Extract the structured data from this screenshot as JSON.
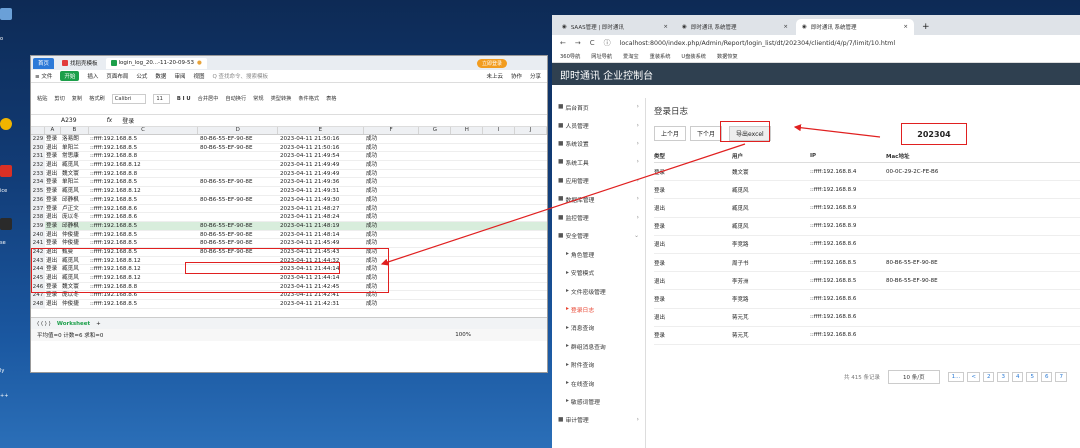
{
  "desktop": {
    "labels": [
      "o",
      "ice",
      "se",
      "ly",
      "++"
    ]
  },
  "excel": {
    "tabs": [
      {
        "label": "首页"
      },
      {
        "label": "找稻壳模板"
      },
      {
        "label": "login_log_20...-11-20-09-53"
      }
    ],
    "tab_dot": "●",
    "login_label": "立即登录",
    "menu": [
      "≡ 文件",
      "开始",
      "插入",
      "页面布局",
      "公式",
      "数据",
      "审阅",
      "视图",
      "Q 查找命令、搜索模板"
    ],
    "menu_right": [
      "未上云",
      "协作",
      "分享"
    ],
    "ribbon": [
      "粘贴",
      "剪切",
      "复制",
      "格式刷",
      "Calibri",
      "11",
      "B I U",
      "合并居中",
      "自动换行",
      "常规",
      "类型转换",
      "条件格式",
      "表格"
    ],
    "cell_ref": "A239",
    "fx": "fx",
    "formula": "登录",
    "col_headers": [
      "A",
      "B",
      "C",
      "D",
      "E",
      "F",
      "G",
      "H",
      "I",
      "J",
      "K"
    ],
    "rows": [
      [
        "229",
        "登录",
        "洛易朗",
        "::ffff:192.168.8.5",
        "80-B6-55-EF-90-8E",
        "2023-04-11 21:50:16",
        "成功"
      ],
      [
        "230",
        "退出",
        "单阳兰",
        "::ffff:192.168.8.5",
        "80-B6-55-EF-90-8E",
        "2023-04-11 21:50:16",
        "成功"
      ],
      [
        "231",
        "登录",
        "常思康",
        "::ffff:192.168.8.8",
        "",
        "2023-04-11 21:49:54",
        "成功"
      ],
      [
        "232",
        "退出",
        "臧觅风",
        "::ffff:192.168.8.12",
        "",
        "2023-04-11 21:49:49",
        "成功"
      ],
      [
        "233",
        "退出",
        "魏文寰",
        "::ffff:192.168.8.8",
        "",
        "2023-04-11 21:49:49",
        "成功"
      ],
      [
        "234",
        "登录",
        "单阳兰",
        "::ffff:192.168.8.5",
        "80-B6-55-EF-90-8E",
        "2023-04-11 21:49:36",
        "成功"
      ],
      [
        "235",
        "登录",
        "臧觅风",
        "::ffff:192.168.8.12",
        "",
        "2023-04-11 21:49:31",
        "成功"
      ],
      [
        "236",
        "登录",
        "邱静枫",
        "::ffff:192.168.8.5",
        "80-B6-55-EF-90-8E",
        "2023-04-11 21:49:30",
        "成功"
      ],
      [
        "237",
        "登录",
        "卢正文",
        "::ffff:192.168.8.6",
        "",
        "2023-04-11 21:48:27",
        "成功"
      ],
      [
        "238",
        "退出",
        "庞以冬",
        "::ffff:192.168.8.6",
        "",
        "2023-04-11 21:48:24",
        "成功"
      ],
      [
        "239",
        "登录",
        "邱静枫",
        "::ffff:192.168.8.5",
        "80-B6-55-EF-90-8E",
        "2023-04-11 21:48:19",
        "成功"
      ],
      [
        "240",
        "退出",
        "仲俊捷",
        "::ffff:192.168.8.5",
        "80-B6-55-EF-90-8E",
        "2023-04-11 21:48:14",
        "成功"
      ],
      [
        "241",
        "登录",
        "仲俊捷",
        "::ffff:192.168.8.5",
        "80-B6-55-EF-90-8E",
        "2023-04-11 21:45:49",
        "成功"
      ],
      [
        "242",
        "退出",
        "甄曼",
        "::ffff:192.168.8.5",
        "80-B6-55-EF-90-8E",
        "2023-04-11 21:45:43",
        "成功"
      ],
      [
        "243",
        "退出",
        "臧觅风",
        "::ffff:192.168.8.12",
        "",
        "2023-04-11 21:44:32",
        "成功"
      ],
      [
        "244",
        "登录",
        "臧觅风",
        "::ffff:192.168.8.12",
        "",
        "2023-04-11 21:44:14",
        "成功"
      ],
      [
        "245",
        "退出",
        "臧觅风",
        "::ffff:192.168.8.12",
        "",
        "2023-04-11 21:44:14",
        "成功"
      ],
      [
        "246",
        "登录",
        "魏文寰",
        "::ffff:192.168.8.8",
        "",
        "2023-04-11 21:42:45",
        "成功"
      ],
      [
        "247",
        "登录",
        "庞以冬",
        "::ffff:192.168.8.6",
        "",
        "2023-04-11 21:42:41",
        "成功"
      ],
      [
        "248",
        "退出",
        "仲俊捷",
        "::ffff:192.168.8.5",
        "",
        "2023-04-11 21:42:31",
        "成功"
      ]
    ],
    "sheet_name": "Worksheet",
    "add_sheet": "+",
    "status_left": "平均值=0 计数=6 求和=0",
    "zoom": "100%"
  },
  "browser": {
    "tabs": [
      "SAAS管理 | 即时通讯",
      "即时通讯 系统管理",
      "即时通讯 系统管理"
    ],
    "new_tab": "+",
    "close": "×",
    "nav": [
      "←",
      "→",
      "C",
      "ⓘ"
    ],
    "url": "localhost:8000/index.php/Admin/Report/login_list/dt/202304/clientid/4/p/7/limit/10.html",
    "bookmarks": [
      "360导航",
      "网址导航",
      "爱淘宝",
      "重装系统",
      "U盘装系统",
      "数据恢复"
    ],
    "app_title": "即时通讯 企业控制台",
    "sidebar": [
      {
        "label": "后台首页",
        "chev": "›",
        "sub": false
      },
      {
        "label": "人员管理",
        "chev": "›",
        "sub": false
      },
      {
        "label": "系统设置",
        "chev": "›",
        "sub": false
      },
      {
        "label": "系统工具",
        "chev": "›",
        "sub": false
      },
      {
        "label": "应用管理",
        "chev": "›",
        "sub": false
      },
      {
        "label": "数据库管理",
        "chev": "›",
        "sub": false
      },
      {
        "label": "监控管理",
        "chev": "›",
        "sub": false
      },
      {
        "label": "安全管理",
        "chev": "⌄",
        "sub": false
      },
      {
        "label": "角色管理",
        "chev": "",
        "sub": true
      },
      {
        "label": "安管模式",
        "chev": "",
        "sub": true
      },
      {
        "label": "文件密级管理",
        "chev": "",
        "sub": true
      },
      {
        "label": "登录日志",
        "chev": "",
        "sub": true,
        "active": true
      },
      {
        "label": "消息查询",
        "chev": "",
        "sub": true
      },
      {
        "label": "群组消息查询",
        "chev": "",
        "sub": true
      },
      {
        "label": "附件查询",
        "chev": "",
        "sub": true
      },
      {
        "label": "在线查询",
        "chev": "",
        "sub": true
      },
      {
        "label": "敏感词管理",
        "chev": "",
        "sub": true
      },
      {
        "label": "审计管理",
        "chev": "›",
        "sub": false
      }
    ],
    "page_title": "登录日志",
    "buttons": [
      "上个月",
      "下个月",
      "导出excel"
    ],
    "month": "202304",
    "table_headers": [
      "类型",
      "用户",
      "IP",
      "Mac地址"
    ],
    "table_rows": [
      [
        "登录",
        "魏文寰",
        "::ffff:192.168.8.4",
        "00-0C-29-2C-FE-B6"
      ],
      [
        "登录",
        "臧觅风",
        "::ffff:192.168.8.9",
        ""
      ],
      [
        "退出",
        "臧觅风",
        "::ffff:192.168.8.9",
        ""
      ],
      [
        "登录",
        "臧觅风",
        "::ffff:192.168.8.9",
        ""
      ],
      [
        "退出",
        "李竞路",
        "::ffff:192.168.8.6",
        ""
      ],
      [
        "登录",
        "周子书",
        "::ffff:192.168.8.5",
        "80-B6-55-EF-90-8E"
      ],
      [
        "退出",
        "李芳洲",
        "::ffff:192.168.8.5",
        "80-B6-55-EF-90-8E"
      ],
      [
        "登录",
        "李竞路",
        "::ffff:192.168.8.6",
        ""
      ],
      [
        "退出",
        "蒋元芃",
        "::ffff:192.168.8.6",
        ""
      ],
      [
        "登录",
        "蒋元芃",
        "::ffff:192.168.8.6",
        ""
      ]
    ],
    "pager": {
      "total": "共 415 条记录",
      "per_page": "10 条/页",
      "pages": [
        "1...",
        "<",
        "2",
        "3",
        "4",
        "5",
        "6",
        "7"
      ]
    }
  },
  "colors": {
    "annotation": "#e02020",
    "sidebar_dark": "#2f4050",
    "excel_green": "#1c9f4a"
  }
}
